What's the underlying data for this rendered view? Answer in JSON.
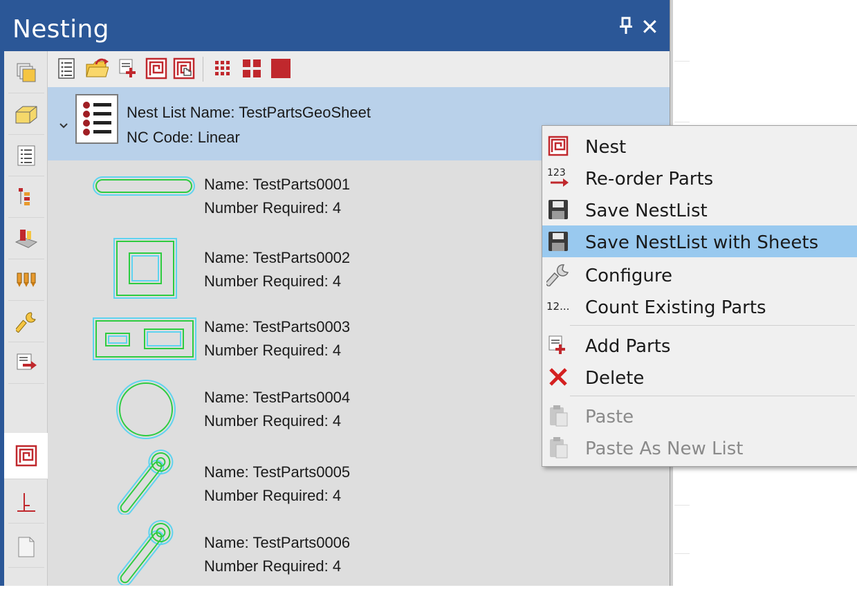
{
  "panel": {
    "title": "Nesting",
    "pin_glyph": "⊥",
    "close_glyph": "✕"
  },
  "toolbar": {
    "icons": [
      "nest-list-icon",
      "open-folder-icon",
      "add-parts-icon",
      "nest-icon",
      "nest-manual-icon",
      "small-grid-icon",
      "medium-grid-icon",
      "large-square-icon"
    ]
  },
  "sidebar": {
    "icons": [
      "layers-icon",
      "box-icon",
      "list-icon",
      "tree-icon",
      "machining-icon",
      "tools-icon",
      "wrench-icon",
      "export-icon",
      "nesting-icon",
      "axis-icon",
      "document-icon"
    ]
  },
  "nest_list": {
    "name_line": "Nest List Name: TestPartsGeoSheet",
    "nc_line": "NC Code: Linear"
  },
  "parts": [
    {
      "name": "Name: TestParts0001",
      "required": "Number Required: 4"
    },
    {
      "name": "Name: TestParts0002",
      "required": "Number Required: 4"
    },
    {
      "name": "Name: TestParts0003",
      "required": "Number Required: 4"
    },
    {
      "name": "Name: TestParts0004",
      "required": "Number Required: 4"
    },
    {
      "name": "Name: TestParts0005",
      "required": "Number Required: 4"
    },
    {
      "name": "Name: TestParts0006",
      "required": "Number Required: 4"
    }
  ],
  "context_menu": {
    "items": [
      {
        "label": "Nest",
        "icon": "nest-icon"
      },
      {
        "label": "Re-order Parts",
        "icon": "reorder-icon",
        "icon_text": "123"
      },
      {
        "label": "Save NestList",
        "icon": "save-icon"
      },
      {
        "label": "Save NestList with Sheets",
        "icon": "save-icon",
        "highlighted": true
      },
      {
        "label": "Configure",
        "icon": "wrench-icon"
      },
      {
        "label": "Count Existing Parts",
        "icon": "count-icon",
        "icon_text": "12..."
      },
      {
        "label": "Add Parts",
        "icon": "add-parts-icon"
      },
      {
        "label": "Delete",
        "icon": "delete-icon"
      },
      {
        "label": "Paste",
        "icon": "paste-icon",
        "disabled": true
      },
      {
        "label": "Paste As New List",
        "icon": "paste-icon",
        "disabled": true
      }
    ]
  },
  "colors": {
    "title_bar": "#2b5797",
    "header_selected": "#b9d1ea",
    "menu_highlight": "#99c9ef",
    "part_outline": "#2ecc40",
    "part_offset": "#5fd3f0",
    "icon_red": "#c0282d"
  }
}
